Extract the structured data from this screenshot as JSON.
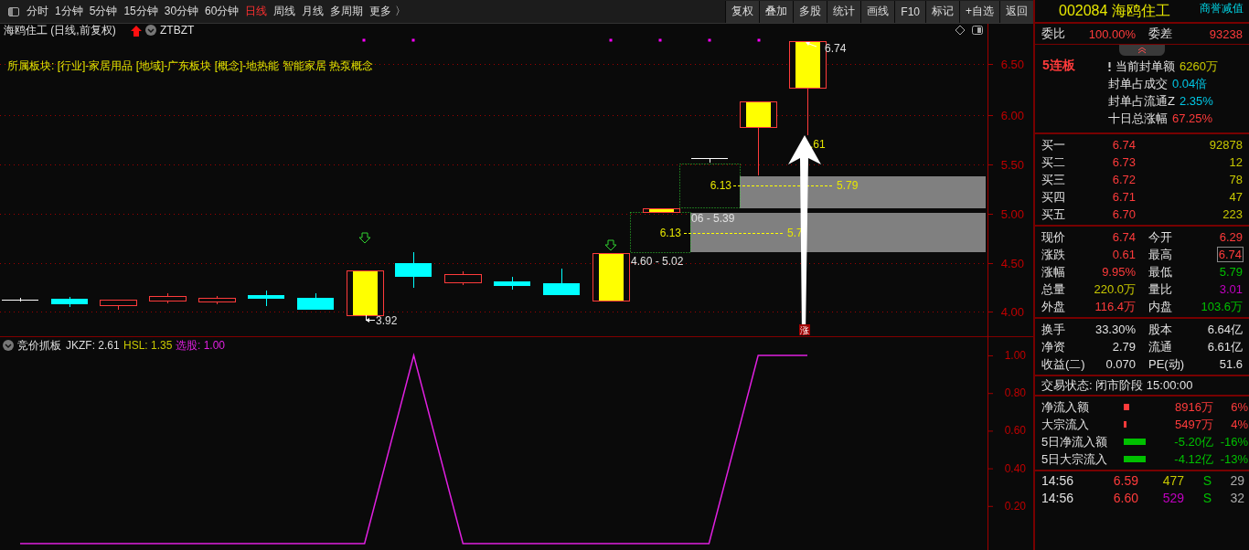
{
  "toolbar": {
    "periods": [
      {
        "label": "分时",
        "selected": false
      },
      {
        "label": "1分钟",
        "selected": false
      },
      {
        "label": "5分钟",
        "selected": false
      },
      {
        "label": "15分钟",
        "selected": false
      },
      {
        "label": "30分钟",
        "selected": false
      },
      {
        "label": "60分钟",
        "selected": false
      },
      {
        "label": "日线",
        "selected": true
      },
      {
        "label": "周线",
        "selected": false
      },
      {
        "label": "月线",
        "selected": false
      },
      {
        "label": "多周期",
        "selected": false
      },
      {
        "label": "更多 〉",
        "selected": false
      }
    ],
    "buttons": [
      "复权",
      "叠加",
      "多股",
      "统计",
      "画线",
      "F10",
      "标记",
      "+自选",
      "返回"
    ]
  },
  "chart": {
    "title": "海鸥住工 (日线,前复权)",
    "formula": "ZTBZT",
    "sectors": "所属板块: [行业]-家居用品 [地域]-广东板块 [概念]-地热能 智能家居 热泵概念",
    "price_axis": [
      "6.50",
      "6.00",
      "5.50",
      "5.00",
      "4.50",
      "4.00"
    ],
    "labels": [
      "6.74",
      "3.92",
      "4.60 - 5.02",
      "06 - 5.39",
      "6.13",
      "5.7",
      "6.13",
      "5.79",
      ".61",
      "涨"
    ]
  },
  "indicator": {
    "name": "竞价抓板",
    "items": [
      {
        "text": "JKZF: 2.61",
        "color": "#dcdcdc"
      },
      {
        "text": "HSL: 1.35",
        "color": "#c8c800"
      },
      {
        "text": "选股: 1.00",
        "color": "#e020e0"
      }
    ],
    "axis": [
      "1.00",
      "0.80",
      "0.60",
      "0.40",
      "0.20"
    ]
  },
  "quote": {
    "code_name": "002084 海鸥住工",
    "tag": "商誉减值",
    "order": [
      {
        "label": "委比",
        "value": "100.00%"
      },
      {
        "label": "委差",
        "value": "93238"
      }
    ],
    "streak": "5连板",
    "seal": [
      {
        "label": "当前封单额",
        "value": "6260万",
        "color": "#c8c800"
      },
      {
        "label": "封单占成交",
        "value": "0.04倍",
        "color": "#00c8e6"
      },
      {
        "label": "封单占流通Z",
        "value": "2.35%",
        "color": "#00c8e6"
      },
      {
        "label": "十日总涨幅",
        "value": "67.25%",
        "color": "#ff3b3b"
      }
    ],
    "bids": [
      {
        "label": "买一",
        "price": "6.74",
        "volume": "92878"
      },
      {
        "label": "买二",
        "price": "6.73",
        "volume": "12"
      },
      {
        "label": "买三",
        "price": "6.72",
        "volume": "78"
      },
      {
        "label": "买四",
        "price": "6.71",
        "volume": "47"
      },
      {
        "label": "买五",
        "price": "6.70",
        "volume": "223"
      }
    ],
    "stats": [
      {
        "label": "现价",
        "value": "6.74",
        "color": "#ff3b3b",
        "boxed": false
      },
      {
        "label": "今开",
        "value": "6.29",
        "color": "#ff3b3b",
        "boxed": false
      },
      {
        "label": "涨跌",
        "value": "0.61",
        "color": "#ff3b3b",
        "boxed": false
      },
      {
        "label": "最高",
        "value": "6.74",
        "color": "#ff3b3b",
        "boxed": true
      },
      {
        "label": "涨幅",
        "value": "9.95%",
        "color": "#ff3b3b",
        "boxed": false
      },
      {
        "label": "最低",
        "value": "5.79",
        "color": "#00c000",
        "boxed": false
      },
      {
        "label": "总量",
        "value": "220.0万",
        "color": "#c8c800",
        "boxed": false
      },
      {
        "label": "量比",
        "value": "3.01",
        "color": "#c000c0",
        "boxed": false
      },
      {
        "label": "外盘",
        "value": "116.4万",
        "color": "#ff3b3b",
        "boxed": false
      },
      {
        "label": "内盘",
        "value": "103.6万",
        "color": "#00c000",
        "boxed": false
      },
      {
        "label": "换手",
        "value": "33.30%",
        "color": "#e0e0e0",
        "boxed": false
      },
      {
        "label": "股本",
        "value": "6.64亿",
        "color": "#e0e0e0",
        "boxed": false
      },
      {
        "label": "净资",
        "value": "2.79",
        "color": "#e0e0e0",
        "boxed": false
      },
      {
        "label": "流通",
        "value": "6.61亿",
        "color": "#e0e0e0",
        "boxed": false
      },
      {
        "label": "收益(二)",
        "value": "0.070",
        "color": "#e0e0e0",
        "boxed": false
      },
      {
        "label": "PE(动)",
        "value": "51.6",
        "color": "#e0e0e0",
        "boxed": false
      }
    ],
    "status": "交易状态: 闭市阶段 15:00:00",
    "flows": [
      {
        "label": "净流入额",
        "color": "#ff3b3b",
        "amount": "8916万",
        "percent": "6%"
      },
      {
        "label": "大宗流入",
        "color": "#ff3b3b",
        "amount": "5497万",
        "percent": "4%"
      },
      {
        "label": "5日净流入额",
        "color": "#00c000",
        "amount": "-5.20亿",
        "percent": "-16%"
      },
      {
        "label": "5日大宗流入",
        "color": "#00c000",
        "amount": "-4.12亿",
        "percent": "-13%"
      }
    ],
    "trades": [
      {
        "time": "14:56",
        "price": "6.59",
        "volume": "477",
        "color": "#c8c800",
        "side": "S",
        "count": "29"
      },
      {
        "time": "14:56",
        "price": "6.60",
        "volume": "529",
        "color": "#c000c0",
        "side": "S",
        "count": "32"
      }
    ]
  }
}
